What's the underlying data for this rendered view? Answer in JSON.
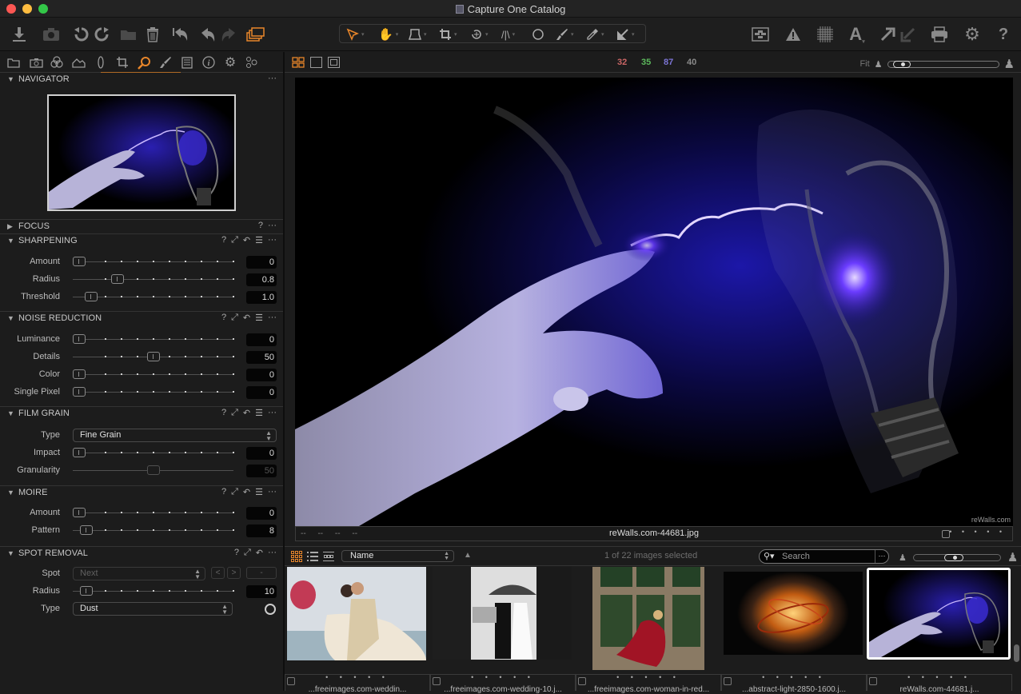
{
  "window": {
    "title": "Capture One Catalog",
    "traffic_lights": {
      "close": "#fc5753",
      "minimize": "#fdbc40",
      "zoom": "#33c748"
    }
  },
  "toolbar": {
    "left": [
      {
        "name": "import-icon",
        "glyph": "⤓",
        "state": "normal"
      },
      {
        "name": "camera-icon",
        "glyph": "📷",
        "state": "dim"
      },
      {
        "name": "rotate-left-icon",
        "glyph": "↺",
        "state": "normal"
      },
      {
        "name": "rotate-right-icon",
        "glyph": "↻",
        "state": "normal"
      },
      {
        "name": "move-to-folder-icon",
        "glyph": "▰",
        "state": "dim"
      },
      {
        "name": "trash-icon",
        "glyph": "🗑",
        "state": "normal"
      },
      {
        "name": "reset-icon",
        "glyph": "⟲",
        "state": "normal"
      },
      {
        "name": "undo-icon",
        "glyph": "↶",
        "state": "normal"
      },
      {
        "name": "redo-icon",
        "glyph": "↷",
        "state": "dim"
      },
      {
        "name": "variants-icon",
        "glyph": "❐",
        "state": "orange"
      }
    ],
    "cursor_tools": [
      {
        "name": "select-cursor-icon",
        "glyph": "➶"
      },
      {
        "name": "pan-hand-icon",
        "glyph": "✋"
      },
      {
        "name": "loupe-tool-icon",
        "glyph": "⏏"
      },
      {
        "name": "crop-tool-icon",
        "glyph": "⌗"
      },
      {
        "name": "rotate-tool-icon",
        "glyph": "⟳"
      },
      {
        "name": "keystone-tool-icon",
        "glyph": "/\\"
      },
      {
        "name": "spot-removal-icon",
        "glyph": "○"
      },
      {
        "name": "brush-icon",
        "glyph": "✎"
      },
      {
        "name": "color-picker-icon",
        "glyph": "✐"
      },
      {
        "name": "copy-apply-icon",
        "glyph": "↙"
      }
    ],
    "right": [
      {
        "name": "before-after-icon",
        "glyph": "▤"
      },
      {
        "name": "exposure-warning-icon",
        "glyph": "▲"
      },
      {
        "name": "grid-icon",
        "glyph": "▦"
      },
      {
        "name": "text-overlay-icon",
        "glyph": "A"
      },
      {
        "name": "copy-adjustments-icon",
        "glyph": "↗"
      },
      {
        "name": "apply-adjustments-icon",
        "glyph": "↙"
      },
      {
        "name": "print-icon",
        "glyph": "⎙"
      },
      {
        "name": "settings-gear-icon",
        "glyph": "⚙"
      },
      {
        "name": "help-icon",
        "glyph": "?"
      }
    ]
  },
  "tool_tabs": [
    {
      "name": "library-tab",
      "glyph": "▭"
    },
    {
      "name": "capture-tab",
      "glyph": "◙"
    },
    {
      "name": "color-tab",
      "glyph": "⊛"
    },
    {
      "name": "exposure-tab",
      "glyph": "⌂"
    },
    {
      "name": "lens-tab",
      "glyph": "()"
    },
    {
      "name": "composition-tab",
      "glyph": "⌗"
    },
    {
      "name": "details-tab",
      "glyph": "⚲",
      "active": true
    },
    {
      "name": "local-adjustments-tab",
      "glyph": "✎"
    },
    {
      "name": "adjustments-tab",
      "glyph": "☰"
    },
    {
      "name": "metadata-tab",
      "glyph": "ⓘ"
    },
    {
      "name": "output-tab",
      "glyph": "⚙"
    },
    {
      "name": "batch-tab",
      "glyph": "⚙"
    }
  ],
  "panels": {
    "navigator": {
      "title": "NAVIGATOR"
    },
    "focus": {
      "title": "FOCUS"
    },
    "sharpening": {
      "title": "SHARPENING",
      "rows": [
        {
          "label": "Amount",
          "value": "0",
          "fraction": 0.0
        },
        {
          "label": "Radius",
          "value": "0.8",
          "fraction": 0.26
        },
        {
          "label": "Threshold",
          "value": "1.0",
          "fraction": 0.08
        }
      ]
    },
    "noise_reduction": {
      "title": "NOISE REDUCTION",
      "rows": [
        {
          "label": "Luminance",
          "value": "0",
          "fraction": 0.0
        },
        {
          "label": "Details",
          "value": "50",
          "fraction": 0.5
        },
        {
          "label": "Color",
          "value": "0",
          "fraction": 0.0
        },
        {
          "label": "Single Pixel",
          "value": "0",
          "fraction": 0.0
        }
      ]
    },
    "film_grain": {
      "title": "FILM GRAIN",
      "type_label": "Type",
      "type_value": "Fine Grain",
      "rows": [
        {
          "label": "Impact",
          "value": "0",
          "fraction": 0.0
        },
        {
          "label": "Granularity",
          "value": "50",
          "fraction": 0.5,
          "disabled": true
        }
      ]
    },
    "moire": {
      "title": "MOIRE",
      "rows": [
        {
          "label": "Amount",
          "value": "0",
          "fraction": 0.0
        },
        {
          "label": "Pattern",
          "value": "8",
          "fraction": 0.05
        }
      ]
    },
    "spot_removal": {
      "title": "SPOT REMOVAL",
      "spot_label": "Spot",
      "spot_value": "Next",
      "prev_label": "<",
      "next_label": ">",
      "remove_label": "-",
      "radius": {
        "label": "Radius",
        "value": "10",
        "fraction": 0.05
      },
      "type_label": "Type",
      "type_value": "Dust"
    }
  },
  "viewer": {
    "layout_buttons": [
      "multi-view",
      "single-view",
      "proof-margin"
    ],
    "color_readout": {
      "r": {
        "value": "32",
        "color": "#c96565"
      },
      "g": {
        "value": "35",
        "color": "#5cb85c"
      },
      "b": {
        "value": "87",
        "color": "#7b74d4"
      },
      "l": {
        "value": "40",
        "color": "#8a8a8a"
      }
    },
    "zoom_label": "Fit",
    "filename": "reWalls.com-44681.jpg",
    "meta_placeholders": [
      "--",
      "--",
      "--",
      "--"
    ],
    "watermark": "reWalls.com",
    "stars": "• • • • •"
  },
  "browser": {
    "sort_value": "Name",
    "selection_text": "1 of 22 images selected",
    "search_placeholder": "Search",
    "thumbnails": [
      {
        "name": "wedding-kiss",
        "caption": "...freeimages.com-weddin...",
        "stars": "• • • • •"
      },
      {
        "name": "wedding-umbrella",
        "caption": "...freeimages.com-wedding-10.j...",
        "stars": "• • • • •"
      },
      {
        "name": "red-dress-window",
        "caption": "...freeimages.com-woman-in-red...",
        "stars": "• • • • •"
      },
      {
        "name": "orange-abstract",
        "caption": "...abstract-light-2850-1600.j...",
        "stars": "• • • • •"
      },
      {
        "name": "lightbulb-hand",
        "caption": "reWalls.com-44681.j...",
        "stars": "• • • • •",
        "selected": true
      }
    ]
  }
}
